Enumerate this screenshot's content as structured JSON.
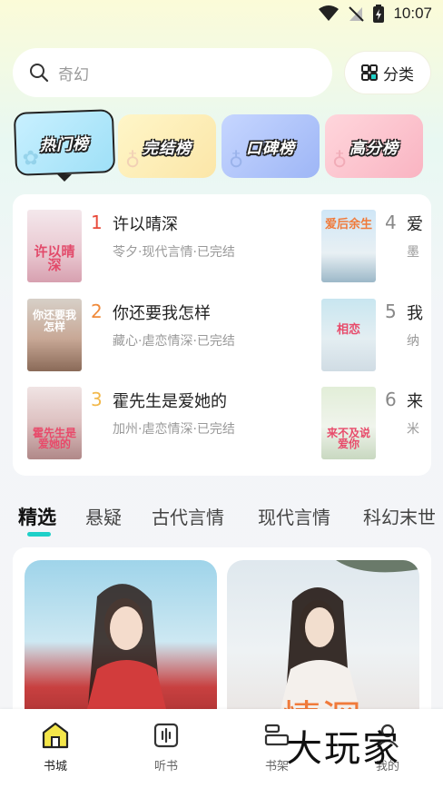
{
  "status_bar": {
    "time": "10:07"
  },
  "search": {
    "placeholder": "奇幻"
  },
  "category_button": {
    "label": "分类"
  },
  "rank_tabs": [
    {
      "label": "热门榜",
      "active": true
    },
    {
      "label": "完结榜"
    },
    {
      "label": "口碑榜"
    },
    {
      "label": "高分榜"
    }
  ],
  "rank_list": [
    {
      "rank": "1",
      "title": "许以晴深",
      "meta": "苓夕·现代言情·已完结",
      "cover_text": "许以晴深",
      "rank_color": "#e84a3a"
    },
    {
      "rank": "2",
      "title": "你还要我怎样",
      "meta": "藏心·虐恋情深·已完结",
      "cover_text": "你还要我怎样",
      "rank_color": "#f08a3a"
    },
    {
      "rank": "3",
      "title": "霍先生是爱她的",
      "meta": "加州·虐恋情深·已完结",
      "cover_text": "霍先生是爱她的",
      "rank_color": "#f2b84a"
    },
    {
      "rank": "4",
      "title": "爱",
      "meta": "墨",
      "cover_text": "爱后余生",
      "rank_color": "#888888"
    },
    {
      "rank": "5",
      "title": "我",
      "meta": "纳",
      "cover_text": "相恋",
      "rank_color": "#888888"
    },
    {
      "rank": "6",
      "title": "来",
      "meta": "米",
      "cover_text": "来不及说爱你",
      "rank_color": "#888888"
    }
  ],
  "category_tabs": [
    {
      "label": "精选",
      "active": true
    },
    {
      "label": "悬疑"
    },
    {
      "label": "古代言情"
    },
    {
      "label": "现代言情"
    },
    {
      "label": "科幻末世"
    }
  ],
  "featured": [
    {
      "cover_text": ""
    },
    {
      "cover_text": "情深"
    }
  ],
  "bottom_nav": [
    {
      "label": "书城",
      "active": true,
      "icon": "home-icon"
    },
    {
      "label": "听书",
      "icon": "audio-icon"
    },
    {
      "label": "书架",
      "icon": "bookshelf-icon"
    },
    {
      "label": "我的",
      "icon": "user-icon"
    }
  ],
  "watermark": "大玩家"
}
